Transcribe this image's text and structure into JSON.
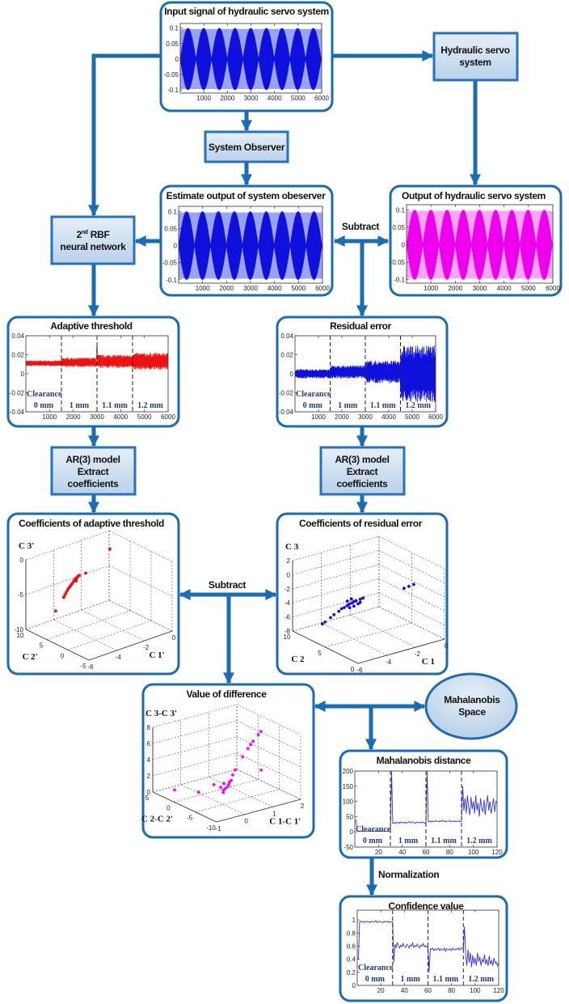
{
  "colors": {
    "arrow": "#1a6db5",
    "frame": "#1b6bb3",
    "blue_signal": "#1010dd",
    "pink_signal": "#ff00ff",
    "red_signal": "#ee1111",
    "clearance_label": "#1f3d7a"
  },
  "blocks": {
    "hydraulic_servo": [
      "Hydraulic servo",
      "system"
    ],
    "system_observer": "System Observer",
    "rbf": {
      "sup_prefix": "2",
      "sup": "nd",
      "suffix": " RBF",
      "line2": "neural network"
    },
    "ar_left": [
      "AR(3) model",
      "Extract",
      "coefficients"
    ],
    "ar_right": [
      "AR(3) model",
      "Extract",
      "coefficients"
    ],
    "mahalanobis_space": [
      "Mahalanobis",
      "Space"
    ]
  },
  "labels": {
    "subtract_top": "Subtract",
    "subtract_mid": "Subtract",
    "normalization": "Normalization"
  },
  "clearance": {
    "word": "Clearance",
    "segments": [
      "0 mm",
      "1 mm",
      "1.1 mm",
      "1.2 mm"
    ]
  },
  "chart_data": [
    {
      "id": "input",
      "title": "Input signal of hydraulic servo system",
      "type": "line",
      "color": "#1010dd",
      "xlim": [
        0,
        6000
      ],
      "ylim": [
        -0.11,
        0.115
      ],
      "xticks": [
        1000,
        2000,
        3000,
        4000,
        5000,
        6000
      ],
      "xtick_labels": [
        "1000",
        "2000",
        "3000",
        "4000",
        "5000",
        "6000"
      ],
      "yticks": [
        -0.1,
        -0.05,
        0,
        0.05,
        0.1
      ],
      "ytick_labels": [
        "-0.1",
        "-0.05",
        "0",
        "0.05",
        "0.1"
      ],
      "amplitude": 0.1
    },
    {
      "id": "estimate",
      "title": "Estimate output of system obeserver",
      "type": "line",
      "color": "#1010dd",
      "xlim": [
        0,
        6000
      ],
      "ylim": [
        -0.11,
        0.115
      ],
      "xticks": [
        1000,
        2000,
        3000,
        4000,
        5000,
        6000
      ],
      "xtick_labels": [
        "1000",
        "2000",
        "3000",
        "4000",
        "5000",
        "6000"
      ],
      "yticks": [
        -0.1,
        -0.05,
        0,
        0.05,
        0.1
      ],
      "ytick_labels": [
        "-0.1",
        "-0.05",
        "0",
        "0.05",
        "0.1"
      ],
      "amplitude": 0.1
    },
    {
      "id": "output",
      "title": "Output of hydraulic servo system",
      "type": "line",
      "color": "#ff00ff",
      "xlim": [
        0,
        6000
      ],
      "ylim": [
        -0.11,
        0.115
      ],
      "xticks": [
        1000,
        2000,
        3000,
        4000,
        5000,
        6000
      ],
      "xtick_labels": [
        "1000",
        "2000",
        "3000",
        "4000",
        "5000",
        "6000"
      ],
      "yticks": [
        -0.1,
        -0.05,
        0,
        0.05,
        0.1
      ],
      "ytick_labels": [
        "-0.1",
        "-0.05",
        "0",
        "0.05",
        "0.1"
      ],
      "amplitude": 0.1
    },
    {
      "id": "adaptive",
      "title": "Adaptive threshold",
      "type": "line",
      "color": "#ee1111",
      "xlim": [
        0,
        6000
      ],
      "ylim": [
        -0.04,
        0.04
      ],
      "xticks": [
        1000,
        2000,
        3000,
        4000,
        5000,
        6000
      ],
      "xtick_labels": [
        "1000",
        "2000",
        "3000",
        "4000",
        "5000",
        "6000"
      ],
      "yticks": [
        -0.04,
        -0.02,
        0,
        0.02,
        0.04
      ],
      "ytick_labels": [
        "-0.04",
        "-0.02",
        "0",
        "0.02",
        "0.04"
      ],
      "dividers": [
        1500,
        3000,
        4500
      ],
      "segments": [
        {
          "center": 0.011,
          "half_range": 0.003
        },
        {
          "center": 0.012,
          "half_range": 0.005
        },
        {
          "center": 0.013,
          "half_range": 0.007
        },
        {
          "center": 0.013,
          "half_range": 0.009
        }
      ],
      "spike": {
        "x": 3000,
        "y": 0.029
      }
    },
    {
      "id": "residual",
      "title": "Residual error",
      "type": "line",
      "color": "#1010dd",
      "xlim": [
        0,
        6000
      ],
      "ylim": [
        -0.04,
        0.04
      ],
      "xticks": [
        1000,
        2000,
        3000,
        4000,
        5000,
        6000
      ],
      "xtick_labels": [
        "1000",
        "2000",
        "3000",
        "4000",
        "5000",
        "6000"
      ],
      "yticks": [
        -0.04,
        -0.02,
        0,
        0.02,
        0.04
      ],
      "ytick_labels": [
        "-0.04",
        "-0.02",
        "0",
        "0.02",
        "0.04"
      ],
      "dividers": [
        1500,
        3000,
        4500
      ],
      "segments": [
        {
          "center": 0.0,
          "half_range": 0.005
        },
        {
          "center": 0.002,
          "half_range": 0.007
        },
        {
          "center": 0.002,
          "half_range": 0.012
        },
        {
          "center": 0.0,
          "half_range": 0.03
        }
      ]
    },
    {
      "id": "coef_threshold",
      "title": "Coefficients of adaptive threshold",
      "type": "scatter",
      "color": "#ee1111",
      "xlabel": "C 1'",
      "ylabel": "C 2'",
      "zlabel": "C 3'",
      "xlim": [
        -6,
        0
      ],
      "ylim": [
        -5,
        10
      ],
      "zlim": [
        -10,
        0
      ],
      "xticks": [
        -6,
        -4,
        -2,
        0
      ],
      "yticks": [
        -5,
        0,
        5,
        10
      ],
      "zticks": [
        -10,
        -5,
        0
      ],
      "points": [
        [
          -4.0,
          9.5,
          -8.6
        ],
        [
          -3.7,
          8.6,
          -6.6
        ],
        [
          -3.65,
          8.5,
          -6.3
        ],
        [
          -3.6,
          8.4,
          -6.0
        ],
        [
          -3.55,
          8.3,
          -5.7
        ],
        [
          -3.5,
          8.2,
          -5.4
        ],
        [
          -3.45,
          8.1,
          -5.2
        ],
        [
          -3.4,
          8.0,
          -5.0
        ],
        [
          -3.35,
          7.9,
          -4.8
        ],
        [
          -3.3,
          7.8,
          -4.6
        ],
        [
          -3.25,
          7.7,
          -4.3
        ],
        [
          -3.2,
          7.6,
          -4.1
        ],
        [
          -3.15,
          7.5,
          -3.9
        ],
        [
          -3.1,
          7.4,
          -3.8
        ],
        [
          -3.05,
          7.3,
          -3.6
        ],
        [
          -3.0,
          7.2,
          -3.5
        ],
        [
          -3.1,
          7.5,
          -4.0
        ],
        [
          -3.2,
          7.3,
          -4.2
        ],
        [
          -2.6,
          7.0,
          -3.4
        ],
        [
          -1.0,
          6.5,
          -0.9
        ]
      ]
    },
    {
      "id": "coef_residual",
      "title": "Coefficients of residual error",
      "type": "scatter",
      "color": "#1010dd",
      "xlabel": "C 1",
      "ylabel": "C 2",
      "zlabel": "C 3",
      "xlim": [
        -6,
        0
      ],
      "ylim": [
        0,
        10
      ],
      "zlim": [
        -8,
        2
      ],
      "xticks": [
        -6,
        -4,
        -2,
        0
      ],
      "yticks": [
        0,
        5,
        10
      ],
      "zticks": [
        -8,
        -6,
        -4,
        -2,
        0,
        2
      ],
      "points": [
        [
          -4.3,
          9.2,
          -7.6
        ],
        [
          -4.2,
          9.0,
          -7.3
        ],
        [
          -4.0,
          8.6,
          -6.6
        ],
        [
          -3.9,
          8.3,
          -6.1
        ],
        [
          -3.7,
          8.0,
          -5.6
        ],
        [
          -3.6,
          7.8,
          -5.2
        ],
        [
          -3.5,
          7.6,
          -5.0
        ],
        [
          -3.4,
          7.4,
          -4.7
        ],
        [
          -3.3,
          7.3,
          -4.5
        ],
        [
          -3.2,
          7.1,
          -4.3
        ],
        [
          -3.1,
          7.0,
          -4.1
        ],
        [
          -3.0,
          6.9,
          -4.0
        ],
        [
          -3.4,
          7.0,
          -4.8
        ],
        [
          -3.2,
          6.8,
          -4.6
        ],
        [
          -3.0,
          6.6,
          -4.3
        ],
        [
          -2.9,
          6.5,
          -4.1
        ],
        [
          -2.8,
          6.7,
          -3.8
        ],
        [
          -2.7,
          6.5,
          -3.6
        ],
        [
          -3.3,
          7.6,
          -4.2
        ],
        [
          -3.1,
          7.4,
          -3.9
        ],
        [
          -0.9,
          4.2,
          -2.2
        ],
        [
          -0.7,
          3.9,
          -1.9
        ],
        [
          -0.5,
          3.6,
          -1.6
        ]
      ]
    },
    {
      "id": "difference",
      "title": "Value of difference",
      "type": "scatter",
      "color": "#ff00ff",
      "xlabel": "C 1-C 1'",
      "ylabel": "C 2-C 2'",
      "zlabel": "C 3-C 3'",
      "xlim": [
        -1,
        2
      ],
      "ylim": [
        -10,
        5
      ],
      "zlim": [
        0,
        8
      ],
      "xticks": [
        -1,
        0,
        1,
        2
      ],
      "yticks": [
        -10,
        -5,
        0,
        5
      ],
      "zticks": [
        0,
        2,
        4,
        6,
        8
      ],
      "points": [
        [
          -0.6,
          2.5,
          0.5
        ],
        [
          -0.2,
          -0.5,
          0.6
        ],
        [
          0.3,
          -3.0,
          0.7
        ],
        [
          0.35,
          -2.8,
          0.9
        ],
        [
          0.4,
          -2.9,
          1.1
        ],
        [
          0.45,
          -3.1,
          1.3
        ],
        [
          0.5,
          -3.0,
          1.5
        ],
        [
          0.55,
          -2.8,
          1.7
        ],
        [
          0.6,
          -2.9,
          1.9
        ],
        [
          0.3,
          -2.4,
          1.2
        ],
        [
          0.4,
          -2.5,
          1.6
        ],
        [
          0.2,
          -1.5,
          1.4
        ],
        [
          0.7,
          -2.6,
          2.4
        ],
        [
          0.8,
          -2.5,
          2.9
        ],
        [
          1.1,
          -2.3,
          4.2
        ],
        [
          1.3,
          -2.2,
          5.0
        ],
        [
          1.4,
          -2.2,
          5.4
        ],
        [
          1.5,
          -2.1,
          5.7
        ],
        [
          1.7,
          -2.0,
          6.3
        ],
        [
          1.8,
          -2.0,
          6.6
        ],
        [
          1.5,
          -4.0,
          2.6
        ]
      ]
    },
    {
      "id": "mahalanobis",
      "title": "Mahalanobis distance",
      "type": "line",
      "color": "#3333dd",
      "xlim": [
        0,
        120
      ],
      "ylim": [
        -50,
        200
      ],
      "xticks": [
        20,
        40,
        60,
        80,
        100,
        120
      ],
      "xtick_labels": [
        "20",
        "40",
        "60",
        "80",
        "100",
        "120"
      ],
      "yticks": [
        -50,
        0,
        50,
        100,
        150,
        200
      ],
      "ytick_labels": [
        "-50",
        "0",
        "50",
        "100",
        "150",
        "200"
      ],
      "dividers": [
        30,
        60,
        90
      ],
      "values": [
        40,
        5,
        3,
        2,
        3,
        2,
        2,
        3,
        2,
        2,
        3,
        2,
        2,
        3,
        2,
        2,
        2,
        3,
        2,
        2,
        3,
        2,
        2,
        3,
        2,
        2,
        2,
        3,
        2,
        2,
        200,
        28,
        30,
        27,
        32,
        29,
        31,
        28,
        33,
        30,
        29,
        32,
        28,
        31,
        30,
        34,
        29,
        31,
        33,
        30,
        28,
        32,
        30,
        31,
        29,
        33,
        30,
        32,
        28,
        31,
        200,
        33,
        35,
        32,
        36,
        34,
        33,
        37,
        34,
        35,
        33,
        36,
        34,
        38,
        35,
        33,
        36,
        34,
        35,
        37,
        33,
        35,
        34,
        36,
        33,
        35,
        34,
        36,
        33,
        35,
        150,
        70,
        110,
        60,
        120,
        80,
        55,
        115,
        75,
        100,
        60,
        120,
        70,
        95,
        50,
        110,
        80,
        65,
        105,
        55,
        90,
        120,
        70,
        100,
        60,
        85,
        110,
        65,
        100,
        95
      ]
    },
    {
      "id": "confidence",
      "title": "Confidence value",
      "type": "line",
      "color": "#3333dd",
      "xlim": [
        0,
        120
      ],
      "ylim": [
        0,
        1.15
      ],
      "xticks": [
        20,
        40,
        60,
        80,
        100,
        120
      ],
      "xtick_labels": [
        "20",
        "40",
        "60",
        "80",
        "100",
        "120"
      ],
      "yticks": [
        0,
        0.2,
        0.4,
        0.6,
        0.8,
        1
      ],
      "ytick_labels": [
        "0",
        "0.2",
        "0.4",
        "0.6",
        "0.8",
        "1"
      ],
      "dividers": [
        30,
        60,
        90
      ],
      "values": [
        0.4,
        0.97,
        0.98,
        0.97,
        0.98,
        0.96,
        0.97,
        0.98,
        0.97,
        0.97,
        0.96,
        0.98,
        0.97,
        0.97,
        0.98,
        0.99,
        0.96,
        0.97,
        0.98,
        0.97,
        0.97,
        0.96,
        0.98,
        0.97,
        0.97,
        0.98,
        0.96,
        0.97,
        0.97,
        0.97,
        0.35,
        0.63,
        0.58,
        0.66,
        0.6,
        0.57,
        0.62,
        0.59,
        0.64,
        0.6,
        0.58,
        0.63,
        0.61,
        0.57,
        0.62,
        0.6,
        0.65,
        0.58,
        0.61,
        0.59,
        0.63,
        0.6,
        0.57,
        0.62,
        0.6,
        0.64,
        0.59,
        0.61,
        0.58,
        0.6,
        0.2,
        0.56,
        0.55,
        0.57,
        0.53,
        0.56,
        0.54,
        0.55,
        0.57,
        0.53,
        0.56,
        0.55,
        0.54,
        0.57,
        0.52,
        0.56,
        0.55,
        0.54,
        0.56,
        0.53,
        0.57,
        0.55,
        0.54,
        0.56,
        0.55,
        0.57,
        0.54,
        0.56,
        0.58,
        0.55,
        0.9,
        0.45,
        0.3,
        0.55,
        0.35,
        0.5,
        0.28,
        0.46,
        0.33,
        0.42,
        0.3,
        0.5,
        0.36,
        0.44,
        0.3,
        0.4,
        0.35,
        0.47,
        0.32,
        0.4,
        0.3,
        0.45,
        0.33,
        0.38,
        0.3,
        0.42,
        0.34,
        0.36,
        0.3,
        0.35
      ]
    }
  ]
}
